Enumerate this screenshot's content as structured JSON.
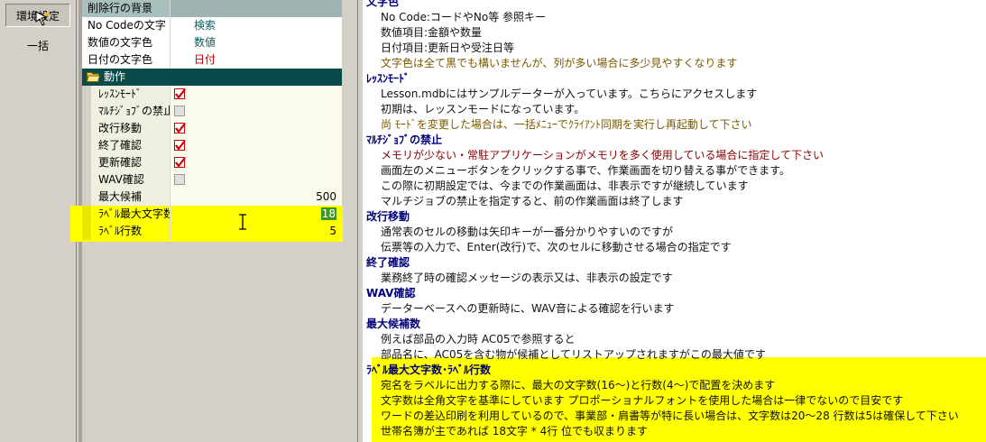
{
  "toolbar": {
    "env_settings": "環境設定",
    "bulk": "一括"
  },
  "grid": {
    "rows": [
      {
        "label": "削除行の背景",
        "value": ""
      },
      {
        "label": "No Codeの文字",
        "value": "検索",
        "color": "#0b6060"
      },
      {
        "label": "数値の文字色",
        "value": "数値",
        "color": "#0b6060"
      },
      {
        "label": "日付の文字色",
        "value": "日付",
        "color": "#c00000"
      }
    ],
    "section": "動作",
    "behavior": [
      {
        "label": "ﾚｯｽﾝﾓｰﾄﾞ",
        "checked": true
      },
      {
        "label": "ﾏﾙﾁｼﾞｮﾌﾞの禁止",
        "checked": false
      },
      {
        "label": "改行移動",
        "checked": true
      },
      {
        "label": "終了確認",
        "checked": true
      },
      {
        "label": "更新確認",
        "checked": true
      },
      {
        "label": "WAV確認",
        "checked": false
      }
    ],
    "max_candidates": {
      "label": "最大候補",
      "value": "500"
    },
    "label_max_chars": {
      "label": "ﾗﾍﾞﾙ最大文字数",
      "value": "18"
    },
    "label_lines": {
      "label": "ﾗﾍﾞﾙ行数",
      "value": "5"
    }
  },
  "help": {
    "lines": [
      {
        "t": "文字色",
        "k": "h"
      },
      {
        "t": "No Code:コードやNo等  参照キー",
        "k": "p"
      },
      {
        "t": "数値項目:金額や数量",
        "k": "p"
      },
      {
        "t": "日付項目:更新日や受注日等",
        "k": "p"
      },
      {
        "t": "文字色は全て黒でも構いませんが、列が多い場合に多少見やすくなります",
        "k": "n"
      },
      {
        "t": "ﾚｯｽﾝﾓｰﾄﾞ",
        "k": "h"
      },
      {
        "t": "Lesson.mdbにはサンプルデーターが入っています。こちらにアクセスします",
        "k": "p"
      },
      {
        "t": "初期は、レッスンモードになっています。",
        "k": "p"
      },
      {
        "t": "尚 ﾓｰﾄﾞを変更した場合は、一括ﾒﾆｭｰでｸﾗｲｱﾝﾄ同期を実行し再起動して下さい",
        "k": "n"
      },
      {
        "t": "ﾏﾙﾁｼﾞｮﾌﾞの禁止",
        "k": "h"
      },
      {
        "t": "メモリが少ない・常駐アプリケーションがメモリを多く使用している場合に指定して下さい",
        "k": "m"
      },
      {
        "t": "画面左のメニューボタンをクリックする事で、作業画面を切り替える事ができます。",
        "k": "p"
      },
      {
        "t": "この際に初期設定では、今までの作業画面は、非表示ですが継続しています",
        "k": "p"
      },
      {
        "t": "マルチジョブの禁止を指定すると、前の作業画面は終了します",
        "k": "p"
      },
      {
        "t": "改行移動",
        "k": "h"
      },
      {
        "t": "通常表のセルの移動は矢印キーが一番分かりやすいのですが",
        "k": "p"
      },
      {
        "t": "伝票等の入力で、Enter(改行)で、次のセルに移動させる場合の指定です",
        "k": "p"
      },
      {
        "t": "終了確認",
        "k": "h"
      },
      {
        "t": "業務終了時の確認メッセージの表示又は、非表示の設定です",
        "k": "p"
      },
      {
        "t": "WAV確認",
        "k": "h"
      },
      {
        "t": "データーベースへの更新時に、WAV音による確認を行います",
        "k": "p"
      },
      {
        "t": "最大候補数",
        "k": "h"
      },
      {
        "t": "例えば部品の入力時  AC05で参照すると",
        "k": "p"
      },
      {
        "t": "部品名に、AC05を含む物が候補としてリストアップされますがこの最大値です",
        "k": "p"
      },
      {
        "t": "ﾗﾍﾞﾙ最大文字数･ﾗﾍﾞﾙ行数",
        "k": "h"
      },
      {
        "t": "宛名をラベルに出力する際に、最大の文字数(16～)と行数(4～)で配置を決めます",
        "k": "p"
      },
      {
        "t": "文字数は全角文字を基準にしています  プロポーショナルフォントを使用した場合は一律でないので目安です",
        "k": "p"
      },
      {
        "t": "ワードの差込印刷を利用しているので、事業部・肩書等が特に長い場合は、文字数は20～28  行数は5は確保して下さい",
        "k": "p"
      },
      {
        "t": "世帯名簿が主であれば   18文字  *  4行  位でも収まります",
        "k": "p"
      }
    ]
  }
}
